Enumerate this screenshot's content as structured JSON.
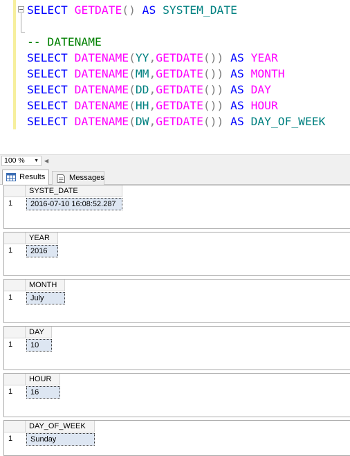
{
  "editor": {
    "lines": [
      [
        {
          "t": "SELECT",
          "c": "kw"
        },
        {
          "t": " ",
          "c": "op"
        },
        {
          "t": "GETDATE",
          "c": "fn"
        },
        {
          "t": "()",
          "c": "op"
        },
        {
          "t": " AS ",
          "c": "kw"
        },
        {
          "t": "SYSTEM_DATE",
          "c": "tk"
        }
      ],
      [],
      [
        {
          "t": "-- DATENAME",
          "c": "cm"
        }
      ],
      [
        {
          "t": "SELECT",
          "c": "kw"
        },
        {
          "t": " ",
          "c": "op"
        },
        {
          "t": "DATENAME",
          "c": "fn"
        },
        {
          "t": "(",
          "c": "op"
        },
        {
          "t": "YY",
          "c": "tk"
        },
        {
          "t": ",",
          "c": "op"
        },
        {
          "t": "GETDATE",
          "c": "fn"
        },
        {
          "t": "())",
          "c": "op"
        },
        {
          "t": " AS ",
          "c": "kw"
        },
        {
          "t": "YEAR",
          "c": "fn"
        }
      ],
      [
        {
          "t": "SELECT",
          "c": "kw"
        },
        {
          "t": " ",
          "c": "op"
        },
        {
          "t": "DATENAME",
          "c": "fn"
        },
        {
          "t": "(",
          "c": "op"
        },
        {
          "t": "MM",
          "c": "tk"
        },
        {
          "t": ",",
          "c": "op"
        },
        {
          "t": "GETDATE",
          "c": "fn"
        },
        {
          "t": "())",
          "c": "op"
        },
        {
          "t": " AS ",
          "c": "kw"
        },
        {
          "t": "MONTH",
          "c": "fn"
        }
      ],
      [
        {
          "t": "SELECT",
          "c": "kw"
        },
        {
          "t": " ",
          "c": "op"
        },
        {
          "t": "DATENAME",
          "c": "fn"
        },
        {
          "t": "(",
          "c": "op"
        },
        {
          "t": "DD",
          "c": "tk"
        },
        {
          "t": ",",
          "c": "op"
        },
        {
          "t": "GETDATE",
          "c": "fn"
        },
        {
          "t": "())",
          "c": "op"
        },
        {
          "t": " AS ",
          "c": "kw"
        },
        {
          "t": "DAY",
          "c": "fn"
        }
      ],
      [
        {
          "t": "SELECT",
          "c": "kw"
        },
        {
          "t": " ",
          "c": "op"
        },
        {
          "t": "DATENAME",
          "c": "fn"
        },
        {
          "t": "(",
          "c": "op"
        },
        {
          "t": "HH",
          "c": "tk"
        },
        {
          "t": ",",
          "c": "op"
        },
        {
          "t": "GETDATE",
          "c": "fn"
        },
        {
          "t": "())",
          "c": "op"
        },
        {
          "t": " AS ",
          "c": "kw"
        },
        {
          "t": "HOUR",
          "c": "fn"
        }
      ],
      [
        {
          "t": "SELECT",
          "c": "kw"
        },
        {
          "t": " ",
          "c": "op"
        },
        {
          "t": "DATENAME",
          "c": "fn"
        },
        {
          "t": "(",
          "c": "op"
        },
        {
          "t": "DW",
          "c": "tk"
        },
        {
          "t": ",",
          "c": "op"
        },
        {
          "t": "GETDATE",
          "c": "fn"
        },
        {
          "t": "())",
          "c": "op"
        },
        {
          "t": " AS ",
          "c": "kw"
        },
        {
          "t": "DAY_OF_WEEK",
          "c": "tk"
        }
      ]
    ]
  },
  "zoom": {
    "value": "100 %"
  },
  "tabs": {
    "results_label": "Results",
    "messages_label": "Messages"
  },
  "results": [
    {
      "column": "SYSTE_DATE",
      "row_number": "1",
      "value": "2016-07-10 16:08:52.287"
    },
    {
      "column": "YEAR",
      "row_number": "1",
      "value": "2016"
    },
    {
      "column": "MONTH",
      "row_number": "1",
      "value": "July"
    },
    {
      "column": "DAY",
      "row_number": "1",
      "value": "10"
    },
    {
      "column": "HOUR",
      "row_number": "1",
      "value": "16"
    },
    {
      "column": "DAY_OF_WEEK",
      "row_number": "1",
      "value": "Sunday"
    }
  ]
}
